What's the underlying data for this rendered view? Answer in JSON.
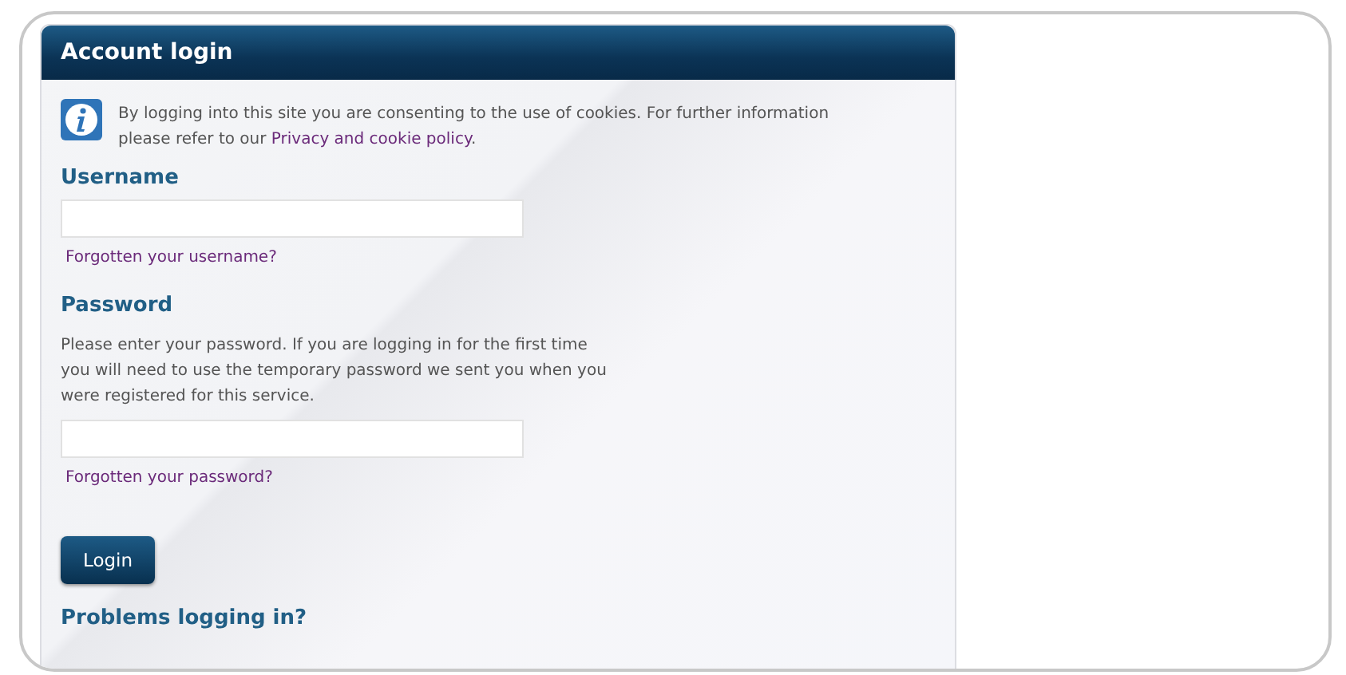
{
  "panel": {
    "title": "Account login"
  },
  "notice": {
    "text_before": "By logging into this site you are consenting to the use of cookies. For further information please refer to our ",
    "link": "Privacy and cookie policy",
    "text_after": "."
  },
  "username": {
    "label": "Username",
    "forgot_link": "Forgotten your username?"
  },
  "password": {
    "label": "Password",
    "help": "Please enter your password. If you are logging in for the first time you will need to use the temporary password we sent you when you were registered for this service.",
    "forgot_link": "Forgotten your password?"
  },
  "login_button": "Login",
  "problems_heading": "Problems logging in?"
}
